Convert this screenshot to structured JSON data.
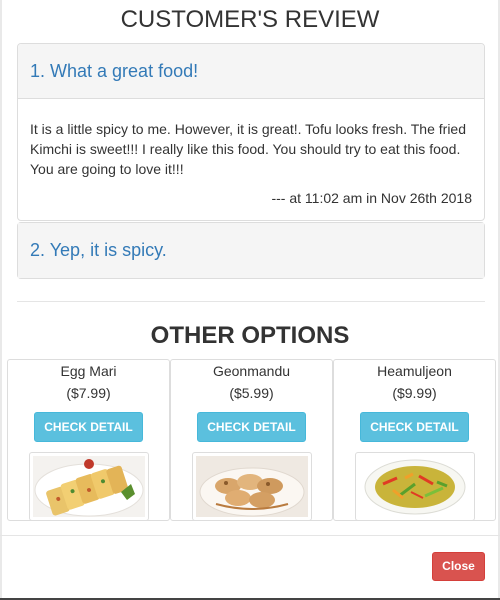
{
  "modal": {
    "title": "CUSTOMER'S REVIEW",
    "close_label": "Close"
  },
  "reviews": [
    {
      "heading": "1. What a great food!",
      "body": "It is a little spicy to me. However, it is great!. Tofu looks fresh. The fried Kimchi is sweet!!! I really like this food. You should try to eat this food. You are going to love it!!!",
      "meta": "--- at 11:02 am in Nov 26th 2018",
      "expanded": true
    },
    {
      "heading": "2. Yep, it is spicy.",
      "expanded": false
    }
  ],
  "other_options": {
    "title": "OTHER OPTIONS",
    "button_label": "CHECK DETAIL",
    "items": [
      {
        "name": "Egg Mari",
        "price": "($7.99)",
        "image": "egg-roll-food-photo"
      },
      {
        "name": "Geonmandu",
        "price": "($5.99)",
        "image": "dumplings-food-photo"
      },
      {
        "name": "Heamuljeon",
        "price": "($9.99)",
        "image": "seafood-pancake-food-photo"
      }
    ]
  },
  "colors": {
    "link": "#337ab7",
    "info_button": "#5bc0de",
    "danger_button": "#d9534f"
  }
}
